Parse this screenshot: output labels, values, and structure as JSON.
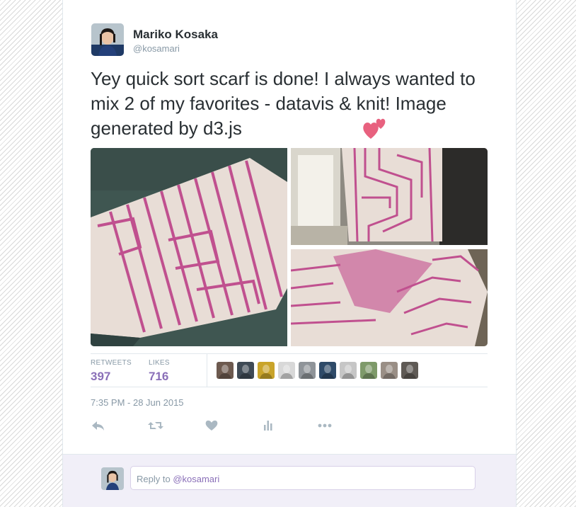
{
  "user": {
    "name": "Mariko Kosaka",
    "handle": "@kosamari"
  },
  "tweet": {
    "text": "Yey quick sort scarf is done!  I always wanted to mix 2 of my favorites - datavis & knit! Image generated by d3.js",
    "emoji": "two-hearts"
  },
  "media": {
    "photos": [
      "scarf-folded-photo",
      "scarf-window-photo",
      "scarf-worn-photo"
    ]
  },
  "stats": {
    "retweets_label": "RETWEETS",
    "retweets_value": "397",
    "likes_label": "LIKES",
    "likes_value": "716"
  },
  "likers": [
    {
      "color": "#6d5a4f"
    },
    {
      "color": "#3f4a55"
    },
    {
      "color": "#c9a42a"
    },
    {
      "color": "#d8d8d8"
    },
    {
      "color": "#8f9499"
    },
    {
      "color": "#2e4a68"
    },
    {
      "color": "#c6c6c6"
    },
    {
      "color": "#7e9a6a"
    },
    {
      "color": "#9a8f86"
    },
    {
      "color": "#5f5a55"
    }
  ],
  "timestamp": "7:35 PM - 28 Jun 2015",
  "actions": [
    "reply-icon",
    "retweet-icon",
    "like-icon",
    "analytics-icon",
    "more-icon"
  ],
  "reply": {
    "prefix": "Reply to ",
    "mention": "@kosamari"
  },
  "colors": {
    "accent": "#8a6fb8",
    "text": "#292f33",
    "muted": "#8899a6",
    "scarf_pink": "#c0508f",
    "scarf_cream": "#e8ddd6"
  }
}
